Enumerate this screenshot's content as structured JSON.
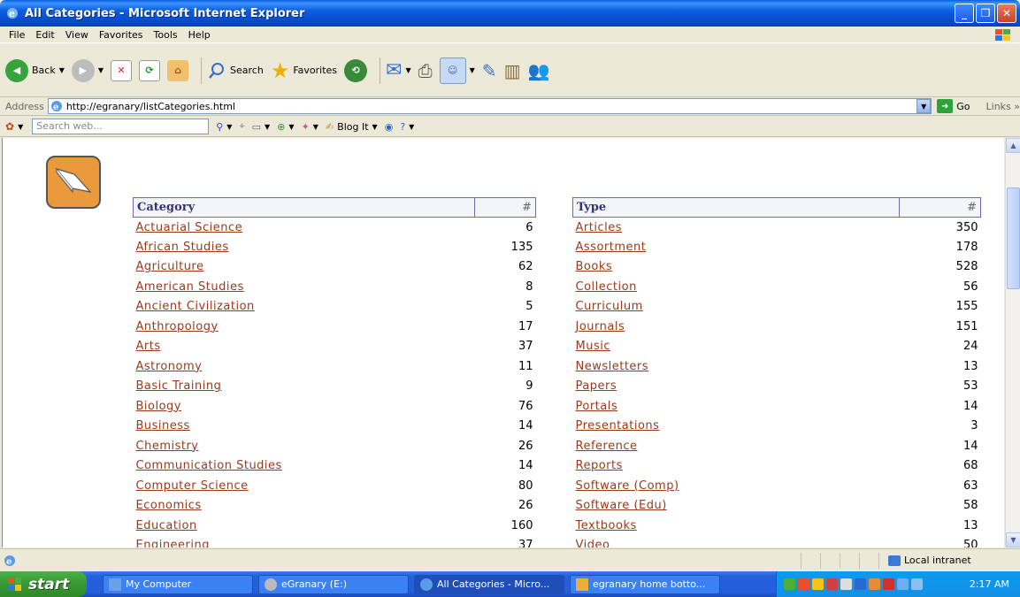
{
  "window": {
    "title": "All Categories - Microsoft Internet Explorer"
  },
  "menu": [
    "File",
    "Edit",
    "View",
    "Favorites",
    "Tools",
    "Help"
  ],
  "toolbar": {
    "back": "Back",
    "search": "Search",
    "favorites": "Favorites"
  },
  "address": {
    "label": "Address",
    "url": "http://egranary/listCategories.html",
    "go": "Go",
    "links": "Links"
  },
  "searchbar": {
    "placeholder": "Search web...",
    "blog": "Blog It"
  },
  "categories": {
    "header": "Category",
    "count_header": "#",
    "rows": [
      {
        "name": "Actuarial Science",
        "count": "6"
      },
      {
        "name": "African Studies",
        "count": "135"
      },
      {
        "name": "Agriculture",
        "count": "62"
      },
      {
        "name": "American Studies",
        "count": "8"
      },
      {
        "name": "Ancient Civilization",
        "count": "5"
      },
      {
        "name": "Anthropology",
        "count": "17"
      },
      {
        "name": "Arts",
        "count": "37"
      },
      {
        "name": "Astronomy",
        "count": "11"
      },
      {
        "name": "Basic Training",
        "count": "9"
      },
      {
        "name": "Biology",
        "count": "76"
      },
      {
        "name": "Business",
        "count": "14"
      },
      {
        "name": "Chemistry",
        "count": "26"
      },
      {
        "name": "Communication Studies",
        "count": "14"
      },
      {
        "name": "Computer Science",
        "count": "80"
      },
      {
        "name": "Economics",
        "count": "26"
      },
      {
        "name": "Education",
        "count": "160"
      },
      {
        "name": "Engineering",
        "count": "37"
      }
    ]
  },
  "types": {
    "header": "Type",
    "count_header": "#",
    "rows": [
      {
        "name": "Articles",
        "count": "350"
      },
      {
        "name": "Assortment",
        "count": "178"
      },
      {
        "name": "Books",
        "count": "528"
      },
      {
        "name": "Collection",
        "count": "56"
      },
      {
        "name": "Curriculum",
        "count": "155"
      },
      {
        "name": "Journals",
        "count": "151"
      },
      {
        "name": "Music",
        "count": "24"
      },
      {
        "name": "Newsletters",
        "count": "13"
      },
      {
        "name": "Papers",
        "count": "53"
      },
      {
        "name": "Portals",
        "count": "14"
      },
      {
        "name": "Presentations",
        "count": "3"
      },
      {
        "name": "Reference",
        "count": "14"
      },
      {
        "name": "Reports",
        "count": "68"
      },
      {
        "name": "Software (Comp)",
        "count": "63"
      },
      {
        "name": "Software (Edu)",
        "count": "58"
      },
      {
        "name": "Textbooks",
        "count": "13"
      },
      {
        "name": "Video",
        "count": "50"
      }
    ]
  },
  "status": {
    "zone": "Local intranet"
  },
  "taskbar": {
    "start": "start",
    "tasks": [
      "My Computer",
      "eGranary (E:)",
      "All Categories - Micro...",
      "egranary home botto..."
    ],
    "clock": "2:17 AM"
  }
}
